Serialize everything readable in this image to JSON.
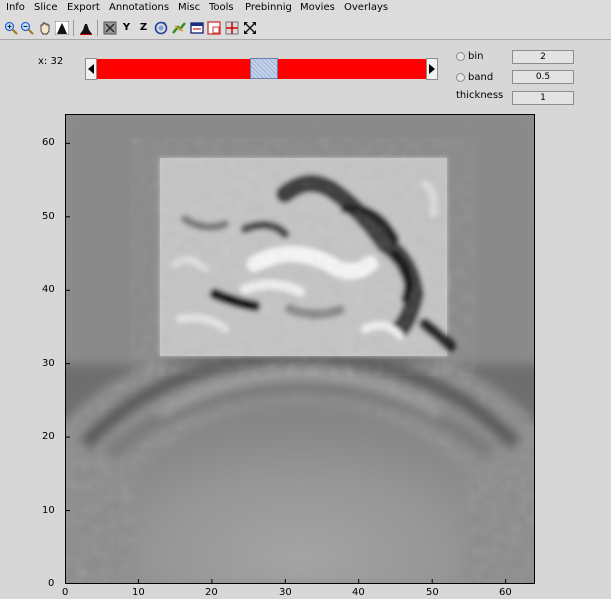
{
  "menu": [
    "Info",
    "Slice",
    "Export",
    "Annotations",
    "Misc",
    "Tools",
    "Prebinnig",
    "Movies",
    "Overlays"
  ],
  "toolbar": {
    "tools": [
      "zoom-in-icon",
      "zoom-out-icon",
      "pan-hand-icon",
      "histogram-icon",
      "histogram-icon",
      "x-axis-icon",
      "y-axis-icon",
      "z-axis-icon",
      "rotate-icon",
      "colormap-icon",
      "window-icon",
      "box-icon",
      "crosshair-icon",
      "fullscreen-icon"
    ],
    "y_label": "Y",
    "z_label": "Z"
  },
  "slice": {
    "label": "x: 32",
    "value": 32,
    "min": 0,
    "max": 63
  },
  "options": {
    "bin_label": "bin",
    "bin_value": "2",
    "band_label": "band",
    "band_value": "0.5",
    "thickness_label": "thickness",
    "thickness_value": "1"
  },
  "plot": {
    "x_ticks": [
      "0",
      "10",
      "20",
      "30",
      "40",
      "50",
      "60"
    ],
    "y_ticks": [
      "0",
      "10",
      "20",
      "30",
      "40",
      "50",
      "60"
    ],
    "xlim": [
      0,
      64
    ],
    "ylim": [
      0,
      64
    ],
    "colors": {
      "slider_track": "#ff0000",
      "background": "#d7d7d7"
    }
  }
}
